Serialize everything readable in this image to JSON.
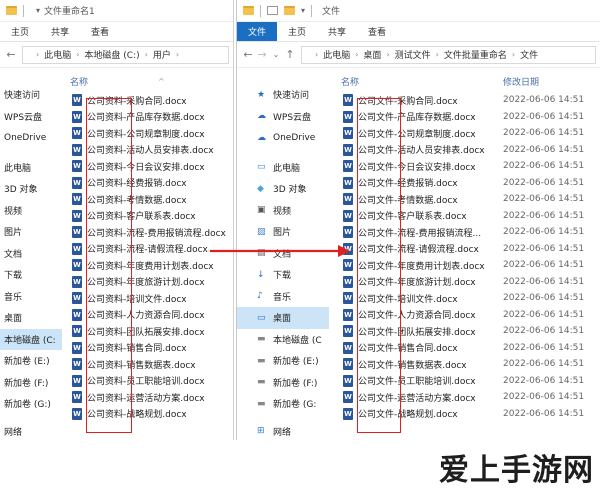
{
  "left_window": {
    "title": "文件重命名1",
    "ribbon_tabs": [
      "主页",
      "共享",
      "查看"
    ],
    "breadcrumb": [
      "此电脑",
      "本地磁盘 (C:)",
      "用户"
    ],
    "column_name": "名称",
    "nav_items": [
      "快速访问",
      "WPS云盘",
      "OneDrive",
      "此电脑",
      "3D 对象",
      "视频",
      "图片",
      "文档",
      "下载",
      "音乐",
      "桌面",
      "本地磁盘 (C:",
      "新加卷 (E:)",
      "新加卷 (F:)",
      "新加卷 (G:)",
      "网络"
    ],
    "files": [
      "公司资料-采购合同.docx",
      "公司资料-产品库存数据.docx",
      "公司资料-公司规章制度.docx",
      "公司资料-活动人员安排表.docx",
      "公司资料-今日会议安排.docx",
      "公司资料-经费报销.docx",
      "公司资料-考情数据.docx",
      "公司资料-客户联系表.docx",
      "公司资料-流程-费用报销流程.docx",
      "公司资料-流程-请假流程.docx",
      "公司资料-年度费用计划表.docx",
      "公司资料-年度旅游计划.docx",
      "公司资料-培训文件.docx",
      "公司资料-人力资源合同.docx",
      "公司资料-团队拓展安排.docx",
      "公司资料-销售合同.docx",
      "公司资料-销售数据表.docx",
      "公司资料-员工职能培训.docx",
      "公司资料-运营活动方案.docx",
      "公司资料-战略规划.docx"
    ]
  },
  "right_window": {
    "title": "文件",
    "ribbon_tabs": [
      "文件",
      "主页",
      "共享",
      "查看"
    ],
    "breadcrumb": [
      "此电脑",
      "桌面",
      "测试文件",
      "文件批量重命名",
      "文件"
    ],
    "column_name": "名称",
    "column_date": "修改日期",
    "nav_items": [
      "快速访问",
      "WPS云盘",
      "OneDrive",
      "此电脑",
      "3D 对象",
      "视频",
      "图片",
      "文档",
      "下载",
      "音乐",
      "桌面",
      "本地磁盘 (C",
      "新加卷 (E:)",
      "新加卷 (F:)",
      "新加卷 (G:",
      "网络"
    ],
    "files": [
      "公司文件-采购合同.docx",
      "公司文件-产品库存数据.docx",
      "公司文件-公司规章制度.docx",
      "公司文件-活动人员安排表.docx",
      "公司文件-今日会议安排.docx",
      "公司文件-经费报销.docx",
      "公司文件-考情数据.docx",
      "公司文件-客户联系表.docx",
      "公司文件-流程-费用报销流程...",
      "公司文件-流程-请假流程.docx",
      "公司文件-年度费用计划表.docx",
      "公司文件-年度旅游计划.docx",
      "公司文件-培训文件.docx",
      "公司文件-人力资源合同.docx",
      "公司文件-团队拓展安排.docx",
      "公司文件-销售合同.docx",
      "公司文件-销售数据表.docx",
      "公司文件-员工职能培训.docx",
      "公司文件-运营活动方案.docx",
      "公司文件-战略规划.docx"
    ],
    "date": "2022-06-06 14:51"
  },
  "watermark": "爱上手游网",
  "colors": {
    "accent": "#1a6fc4",
    "highlight_box": "#e02020",
    "word_icon": "#2b579a",
    "folder": "#f2c14e"
  }
}
